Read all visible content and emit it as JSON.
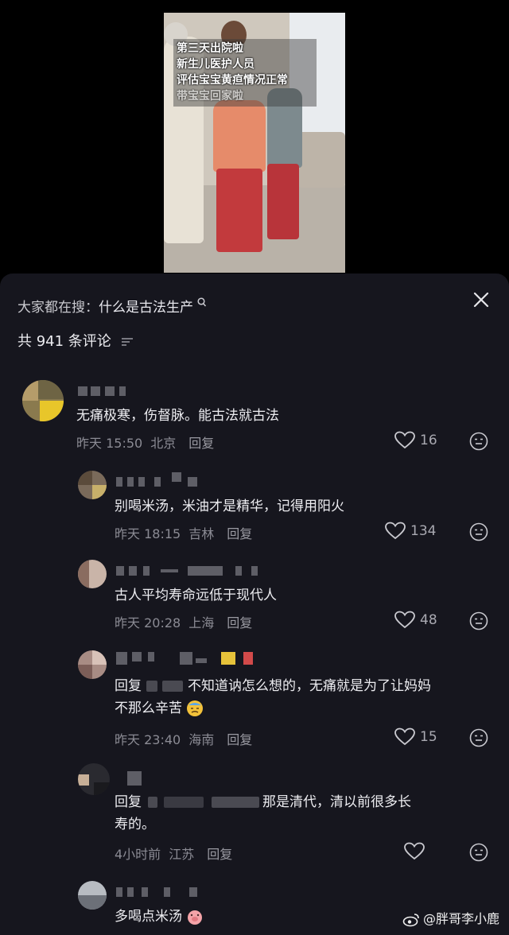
{
  "video": {
    "caption_lines": [
      "第三天出院啦",
      "新生儿医护人员",
      "评估宝宝黄疸情况正常",
      "带宝宝回家啦"
    ]
  },
  "header": {
    "search_prefix": "大家都在搜：",
    "search_term": "什么是古法生产",
    "comment_count": "共 941 条评论"
  },
  "comments": [
    {
      "text": "无痛极寒，伤督脉。能古法就古法",
      "time": "昨天 15:50",
      "location": "北京",
      "reply": "回复",
      "likes": "16"
    },
    {
      "text": "别喝米汤，米油才是精华，记得用阳火",
      "time": "昨天 18:15",
      "location": "吉林",
      "reply": "回复",
      "likes": "134"
    },
    {
      "text": "古人平均寿命远低于现代人",
      "time": "昨天 20:28",
      "location": "上海",
      "reply": "回复",
      "likes": "48"
    },
    {
      "text_prefix": "回复",
      "text_line1": "不知道讷怎么想的，无痛就是为了让妈妈",
      "text_line2": "不那么辛苦",
      "time": "昨天 23:40",
      "location": "海南",
      "reply": "回复",
      "likes": "15"
    },
    {
      "text_prefix": "回复",
      "text_line1": "那是清代，清以前很多长",
      "text_line2": "寿的。",
      "time": "4小时前",
      "location": "江苏",
      "reply": "回复",
      "likes": ""
    },
    {
      "text": "多喝点米汤"
    }
  ],
  "watermark": "@胖哥李小鹿",
  "colors": {
    "panel_bg": "#16161e",
    "text": "#ededf1",
    "meta": "#8b8b94"
  }
}
